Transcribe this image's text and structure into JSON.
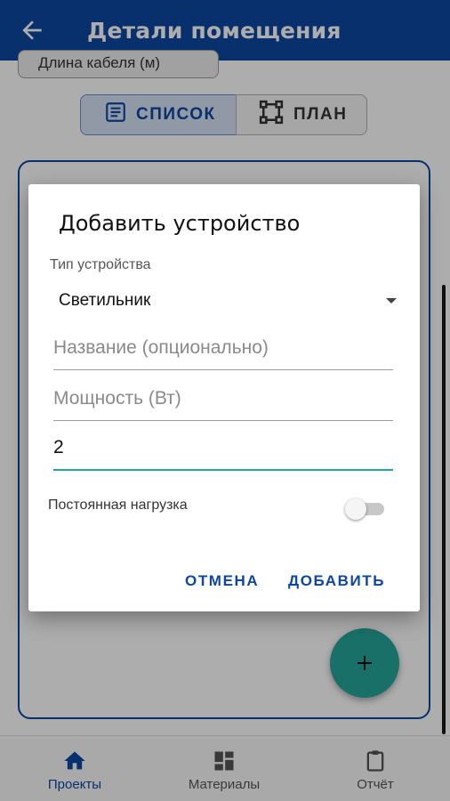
{
  "appbar": {
    "title": "Детали помещения",
    "back_icon": "arrow-back-icon"
  },
  "page": {
    "cable_label": "Длина кабеля (м)",
    "view_toggle": {
      "list_label": "СПИСОК",
      "plan_label": "ПЛАН",
      "selected": "list"
    },
    "fab_icon": "plus-icon"
  },
  "dialog": {
    "title": "Добавить устройство",
    "device_type_caption": "Тип устройства",
    "device_type_value": "Светильник",
    "name_placeholder": "Название (опционально)",
    "power_placeholder": "Мощность (Вт)",
    "count_value": "2",
    "constant_load_label": "Постоянная нагрузка",
    "constant_load_on": false,
    "cancel_label": "ОТМЕНА",
    "add_label": "ДОБАВИТЬ"
  },
  "bottom_nav": {
    "items": [
      {
        "label": "Проекты",
        "icon": "home-icon",
        "active": true
      },
      {
        "label": "Материалы",
        "icon": "dashboard-icon",
        "active": false
      },
      {
        "label": "Отчёт",
        "icon": "clipboard-icon",
        "active": false
      }
    ]
  },
  "colors": {
    "primary": "#0d47a1",
    "accent": "#26a69a",
    "scrim": "rgba(0,0,0,0.32)"
  }
}
